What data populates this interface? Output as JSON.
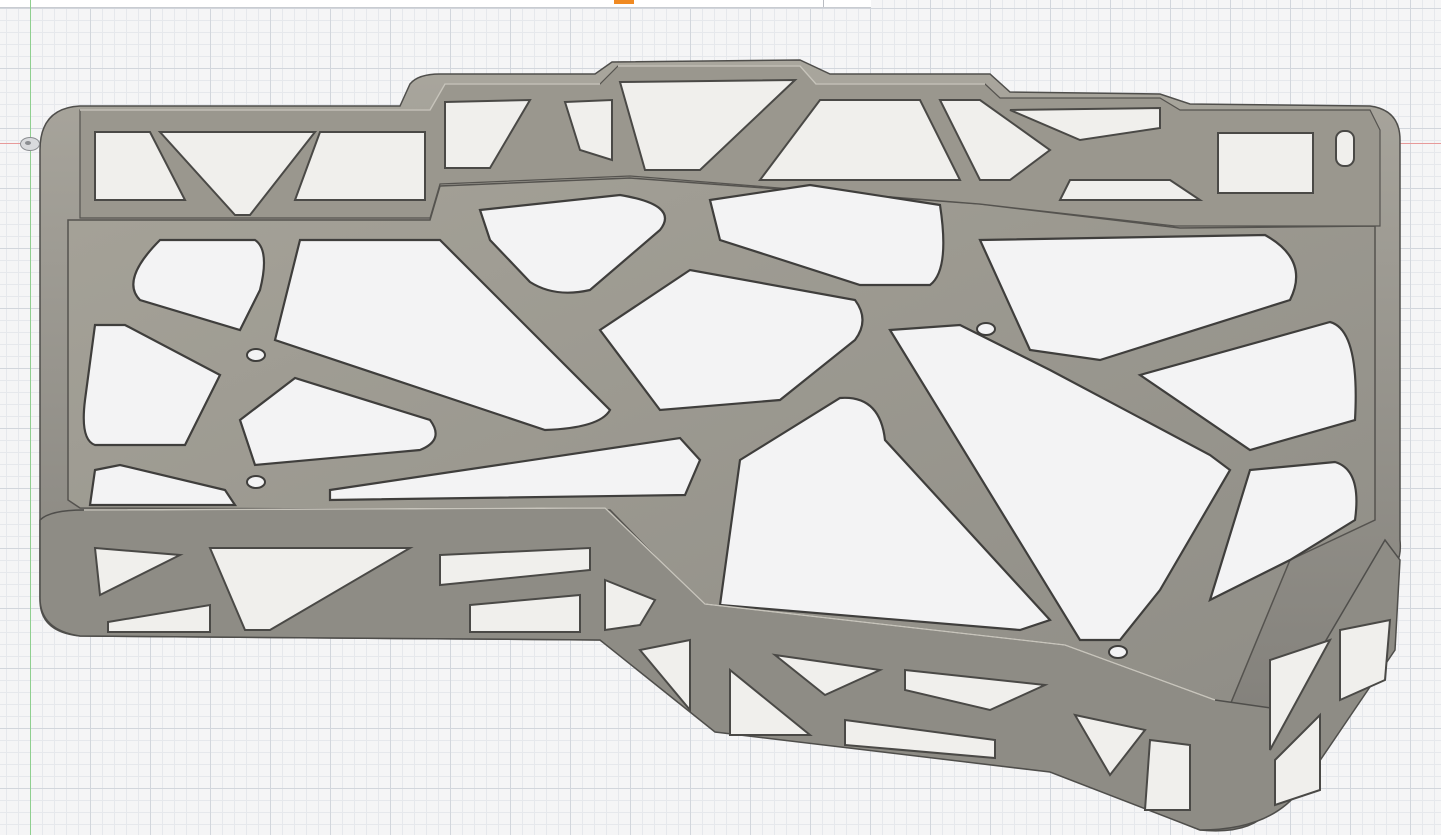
{
  "app": {
    "tab_accent_color": "#f08a22"
  },
  "canvas": {
    "background_color": "#f5f5f6",
    "grid_major_color": "#d2d6dc",
    "grid_minor_color": "#e6e8ec",
    "y_axis_color": "#8fcf8f",
    "x_axis_color": "#e79a9a"
  },
  "model": {
    "icon": "origin-icon",
    "body_color": "#8a8882",
    "top_face_color": "#9b9990",
    "shadow_color": "#6b6a66",
    "highlight_color": "#bcb9b0"
  }
}
